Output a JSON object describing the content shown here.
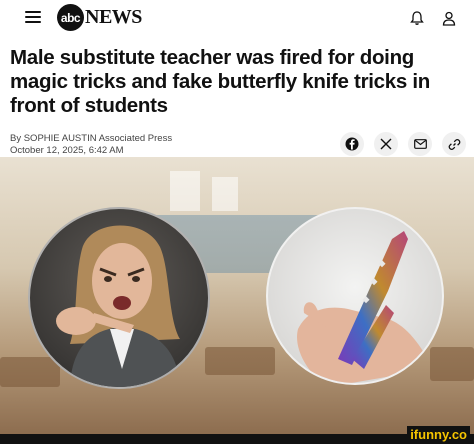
{
  "header": {
    "logo_badge": "abc",
    "logo_word": "NEWS",
    "menu_icon": "hamburger-menu-icon",
    "notifications_icon": "bell-icon",
    "account_icon": "user-icon"
  },
  "article": {
    "headline": "Male substitute teacher was fired for doing magic tricks and fake butterfly knife tricks in front of students",
    "byline": "By SOPHIE AUSTIN Associated Press",
    "timestamp": "October 12, 2025, 6:42 AM"
  },
  "share": {
    "buttons": [
      "facebook-icon",
      "x-icon",
      "email-icon",
      "link-icon"
    ]
  },
  "watermark": "ifunny.co"
}
